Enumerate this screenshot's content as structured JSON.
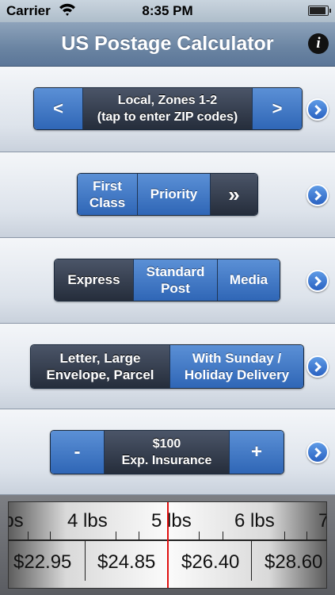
{
  "status_bar": {
    "carrier": "Carrier",
    "time": "8:35 PM"
  },
  "nav_bar": {
    "title": "US Postage Calculator",
    "info_glyph": "i"
  },
  "zone": {
    "prev": "<",
    "label": "Local, Zones 1-2\n(tap to enter ZIP codes)",
    "next": ">"
  },
  "service_row_1": {
    "options": [
      "First\nClass",
      "Priority",
      "»"
    ],
    "selected": "»"
  },
  "service_row_2": {
    "options": [
      "Express",
      "Standard\nPost",
      "Media"
    ],
    "selected": "Express"
  },
  "package_type": {
    "options": [
      "Letter, Large\nEnvelope, Parcel",
      "With Sunday /\nHoliday Delivery"
    ],
    "selected": "Letter, Large\nEnvelope, Parcel"
  },
  "insurance": {
    "minus": "-",
    "label": "$100\nExp. Insurance",
    "plus": "+"
  },
  "weight_picker": {
    "weight_labels": [
      "lbs",
      "4 lbs",
      "5 lbs",
      "6 lbs",
      "7"
    ],
    "price_labels": [
      "$22.95",
      "$24.85",
      "$26.40",
      "$28.60"
    ]
  },
  "colors": {
    "accent_blue": "#2f66b6",
    "selected_dark": "#252d3b",
    "indicator_red": "#e01010"
  }
}
